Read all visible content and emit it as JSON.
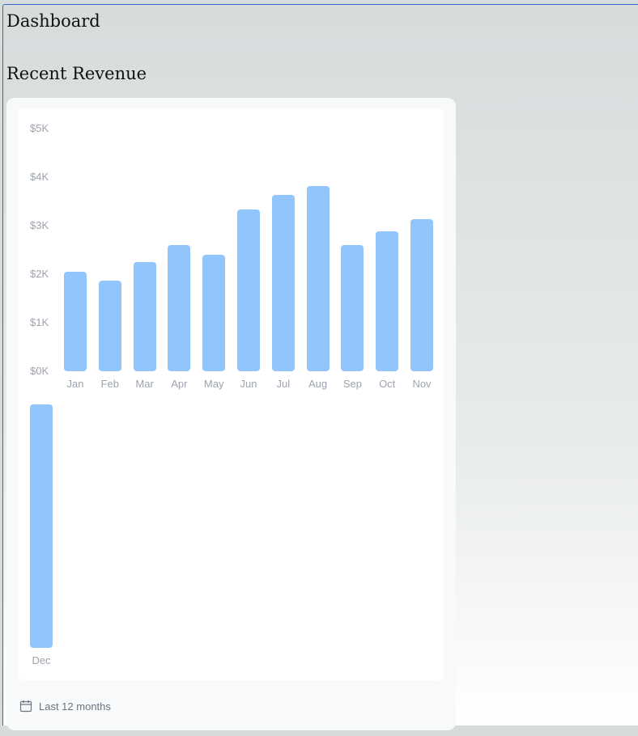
{
  "page": {
    "title": "Dashboard",
    "section_title": "Recent Revenue"
  },
  "chart_data": {
    "type": "bar",
    "categories": [
      "Jan",
      "Feb",
      "Mar",
      "Apr",
      "May",
      "Jun",
      "Jul",
      "Aug",
      "Sep",
      "Oct",
      "Nov",
      "Dec"
    ],
    "values": [
      2100,
      1900,
      2300,
      2650,
      2450,
      3400,
      3700,
      3900,
      2650,
      2950,
      3200,
      5000
    ],
    "y_ticks": [
      "$0K",
      "$1K",
      "$2K",
      "$3K",
      "$4K",
      "$5K"
    ],
    "ylim": [
      0,
      5000
    ],
    "grid": false,
    "bar_color": "#93c5fd"
  },
  "footer": {
    "icon": "calendar-icon",
    "label": "Last 12 months"
  },
  "colors": {
    "bar": "#93c5fd",
    "axis_text": "#9ca3af",
    "card_bg": "#f8f9fb",
    "panel_bg": "#ffffff"
  }
}
